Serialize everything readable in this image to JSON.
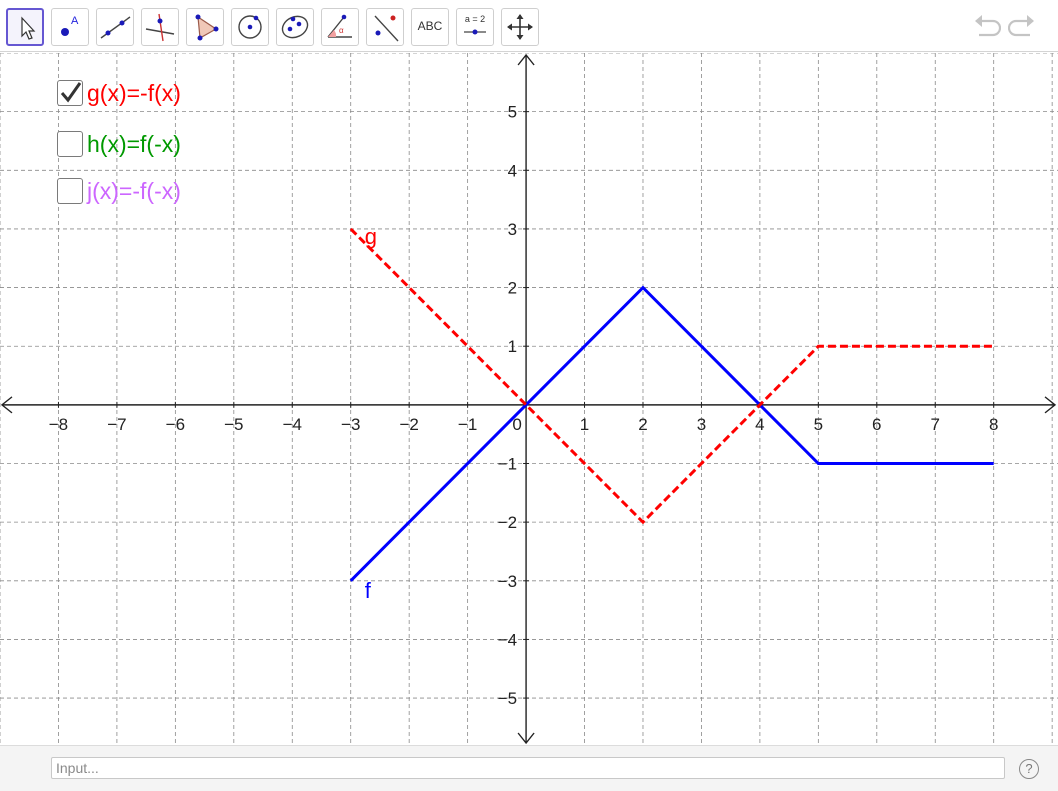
{
  "toolbar": {
    "tools": [
      {
        "name": "move-tool-icon",
        "selected": true
      },
      {
        "name": "point-tool-icon"
      },
      {
        "name": "line-tool-icon"
      },
      {
        "name": "perpendicular-line-tool-icon"
      },
      {
        "name": "polygon-tool-icon"
      },
      {
        "name": "circle-center-point-tool-icon"
      },
      {
        "name": "ellipse-tool-icon"
      },
      {
        "name": "angle-tool-icon"
      },
      {
        "name": "reflect-about-line-tool-icon"
      },
      {
        "name": "text-tool-icon",
        "label": "ABC"
      },
      {
        "name": "slider-tool-icon",
        "label": "a = 2"
      },
      {
        "name": "move-graphics-view-tool-icon"
      }
    ],
    "undo_icon": "undo-icon",
    "redo_icon": "redo-icon"
  },
  "checkboxes": [
    {
      "label": "g(x)=-f(x)",
      "checked": true,
      "color": "#ff0000"
    },
    {
      "label": "h(x)=f(-x)",
      "checked": false,
      "color": "#009900"
    },
    {
      "label": "j(x)=-f(-x)",
      "checked": false,
      "color": "#cc66ff"
    }
  ],
  "chart_data": {
    "type": "line",
    "xlim": [
      -9,
      9.1
    ],
    "ylim": [
      -5.8,
      6
    ],
    "x_ticks": [
      -8,
      -7,
      -6,
      -5,
      -4,
      -3,
      -2,
      -1,
      0,
      1,
      2,
      3,
      4,
      5,
      6,
      7,
      8
    ],
    "y_ticks": [
      -5,
      -4,
      -3,
      -2,
      -1,
      1,
      2,
      3,
      4,
      5
    ],
    "grid": true,
    "series": [
      {
        "name": "f",
        "color": "#0000ff",
        "style": "solid",
        "points": [
          [
            -3,
            -3
          ],
          [
            2,
            2
          ],
          [
            5,
            -1
          ],
          [
            8,
            -1
          ]
        ]
      },
      {
        "name": "g",
        "color": "#ff0000",
        "style": "dashed",
        "points": [
          [
            -3,
            3
          ],
          [
            2,
            -2
          ],
          [
            5,
            1
          ],
          [
            8,
            1
          ]
        ]
      }
    ]
  },
  "input_bar": {
    "placeholder": "Input...",
    "help_label": "?"
  }
}
